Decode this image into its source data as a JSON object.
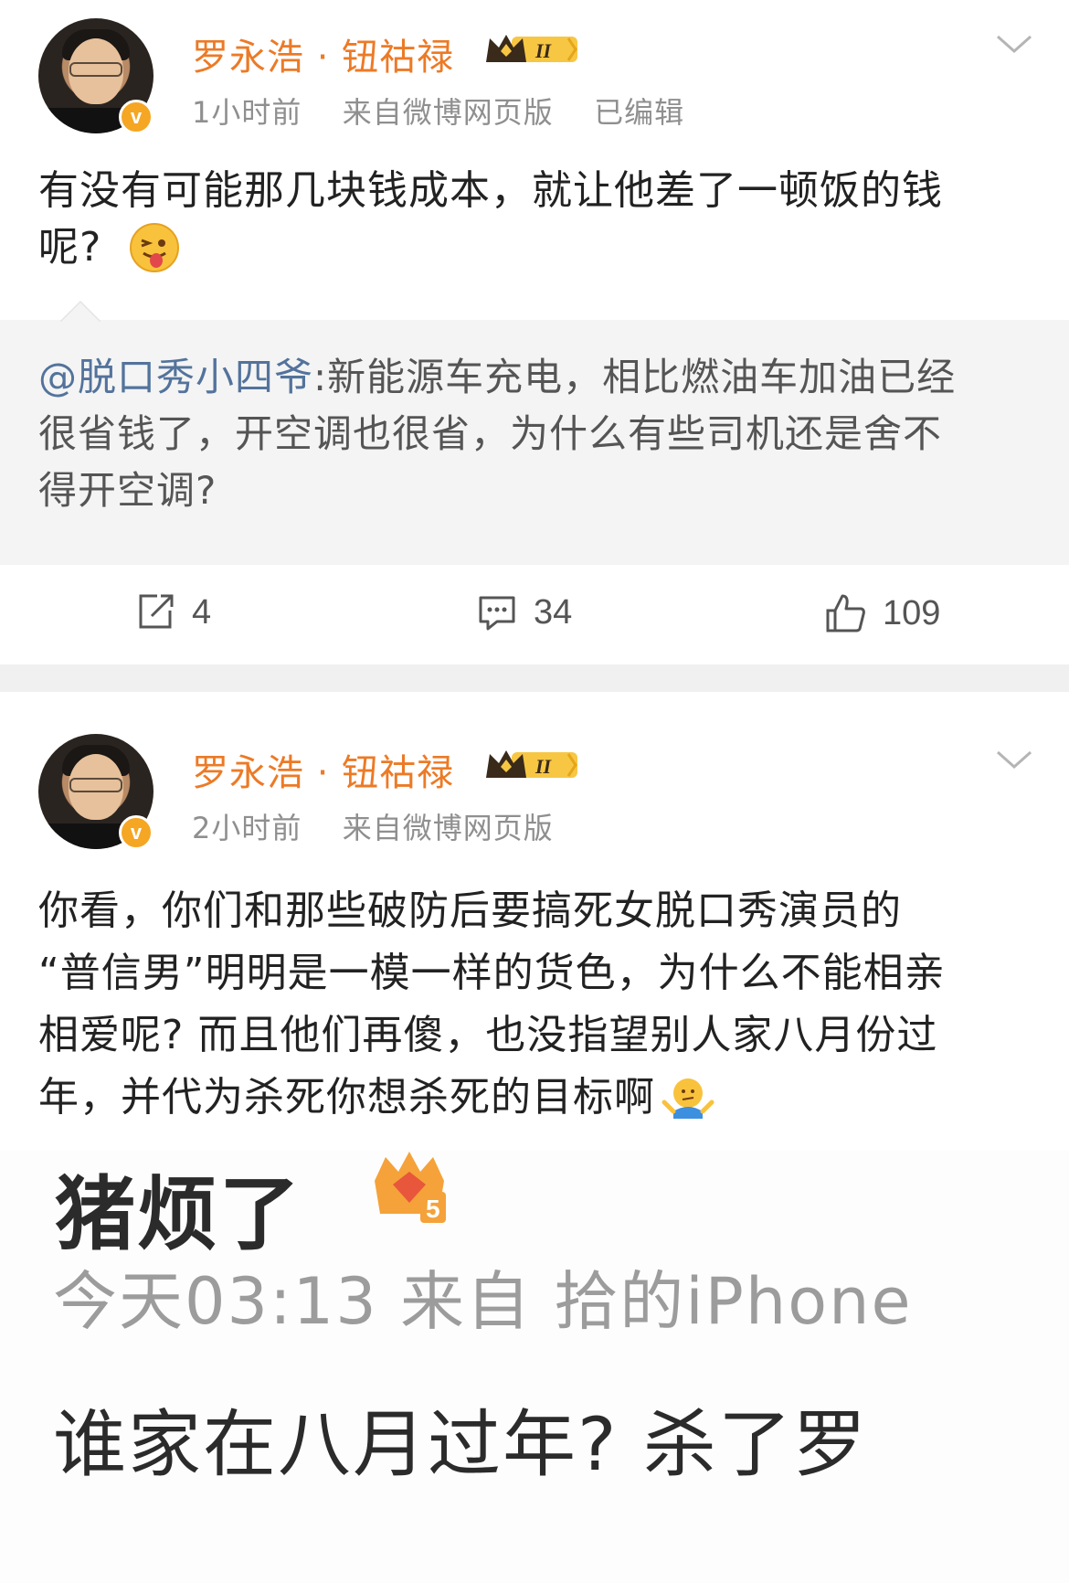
{
  "posts": [
    {
      "username": "罗永浩 · 钮祜禄",
      "badge_level": "II",
      "time": "1小时前",
      "source": "来自微博网页版",
      "edited": "已编辑",
      "text_line1": "有没有可能那几块钱成本，就让他差了一顿饭的钱",
      "text_line2": "呢?",
      "emoji": "tongue-out-emoji",
      "repost": {
        "mention": "@脱口秀小四爷",
        "line1_rest": ":新能源车充电，相比燃油车加油已经",
        "line2": "很省钱了，开空调也很省，为什么有些司机还是舍不",
        "line3": "得开空调?"
      },
      "actions": {
        "repost_count": "4",
        "comment_count": "34",
        "like_count": "109"
      }
    },
    {
      "username": "罗永浩 · 钮祜禄",
      "badge_level": "II",
      "time": "2小时前",
      "source": "来自微博网页版",
      "text_lines": [
        "你看，你们和那些破防后要搞死女脱口秀演员的",
        "“普信男”明明是一模一样的货色，为什么不能相亲",
        "相爱呢? 而且他们再傻，也没指望别人家八月份过",
        "年，并代为杀死你想杀死的目标啊"
      ],
      "emoji": "shrug-emoji",
      "embedded_image": {
        "name": "猪烦了",
        "badge_level": "5",
        "meta": "今天03:13  来自 拾的iPhone",
        "body": "谁家在八月过年? 杀了罗"
      }
    }
  ],
  "colors": {
    "username": "#ec7a26",
    "meta": "#8f8f8f",
    "mention": "#53739c",
    "quote_bg": "#f4f4f4",
    "verified": "#f5a623"
  }
}
